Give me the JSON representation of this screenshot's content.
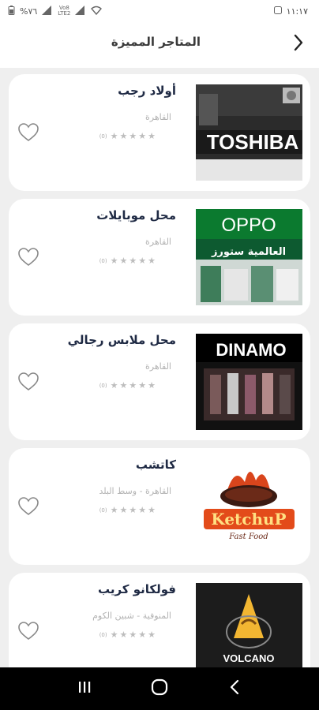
{
  "status_bar": {
    "battery": "%٧٦",
    "network_top": "Vo8",
    "network_bottom": "LTE2",
    "time": "١١:١٧"
  },
  "header": {
    "title": "المتاجر المميزة"
  },
  "stores": [
    {
      "name": "أولاد رجب",
      "location": "القاهرة",
      "rating": 0,
      "rating_count": "(0)",
      "thumb_text": "TOSHIBA"
    },
    {
      "name": "محل موبايلات",
      "location": "القاهرة",
      "rating": 0,
      "rating_count": "(0)",
      "thumb_text": "OPPO",
      "thumb_subtext": "العالمية ستورز"
    },
    {
      "name": "محل ملابس رجالي",
      "location": "القاهرة",
      "rating": 0,
      "rating_count": "(0)",
      "thumb_text": "DINAMO"
    },
    {
      "name": "كاتشب",
      "location": "القاهرة - وسط البلد",
      "rating": 0,
      "rating_count": "(0)",
      "thumb_text": "KetchuP",
      "thumb_subtext": "Fast Food"
    },
    {
      "name": "فولكانو كريب",
      "location": "المنوفية - شبين الكوم",
      "rating": 0,
      "rating_count": "(0)",
      "thumb_text": "VOLCANO"
    }
  ],
  "icons": {
    "back": "chevron-right-icon",
    "favorite": "heart-outline-icon",
    "nav_recents": "recents-icon",
    "nav_home": "home-icon",
    "nav_back": "back-icon"
  },
  "colors": {
    "background": "#efefef",
    "card": "#ffffff",
    "title": "#1f2a44",
    "muted": "#b3b3b3",
    "star": "#bdbdbd"
  }
}
